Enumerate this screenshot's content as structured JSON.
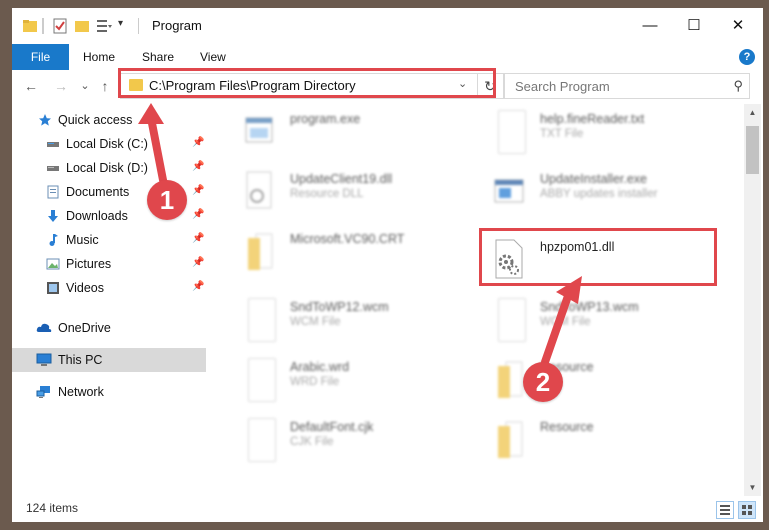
{
  "window": {
    "title": "Program",
    "controls": {
      "minimize": "—",
      "maximize": "☐",
      "close": "✕"
    }
  },
  "ribbon": {
    "tabs": [
      "File",
      "Home",
      "Share",
      "View"
    ],
    "help": "?"
  },
  "navigation": {
    "back": "←",
    "forward": "→",
    "recent": "⌄",
    "up": "↑",
    "address": "C:\\Program Files\\Program Directory",
    "dropdown": "⌄",
    "refresh": "↻",
    "search_placeholder": "Search Program",
    "search_icon": "⚲"
  },
  "sidebar": {
    "items": [
      {
        "label": "Quick access",
        "icon": "star-icon",
        "pinned": false
      },
      {
        "label": "Local Disk (C:)",
        "icon": "drive-icon",
        "pinned": true
      },
      {
        "label": "Local Disk (D:)",
        "icon": "drive-icon",
        "pinned": true
      },
      {
        "label": "Documents",
        "icon": "documents-icon",
        "pinned": true
      },
      {
        "label": "Downloads",
        "icon": "download-icon",
        "pinned": true
      },
      {
        "label": "Music",
        "icon": "music-icon",
        "pinned": true
      },
      {
        "label": "Pictures",
        "icon": "pictures-icon",
        "pinned": true
      },
      {
        "label": "Videos",
        "icon": "video-icon",
        "pinned": true
      },
      {
        "label": "OneDrive",
        "icon": "cloud-icon",
        "pinned": false
      },
      {
        "label": "This PC",
        "icon": "computer-icon",
        "pinned": false,
        "selected": true
      },
      {
        "label": "Network",
        "icon": "network-icon",
        "pinned": false
      }
    ],
    "pin_glyph": "📌"
  },
  "files": [
    {
      "name": "program.exe",
      "type": "",
      "icon": "exe-icon"
    },
    {
      "name": "help.fineReader.txt",
      "type": "TXT File",
      "icon": "text-file-icon"
    },
    {
      "name": "UpdateClient19.dll",
      "type": "Resource DLL",
      "icon": "dll-icon"
    },
    {
      "name": "UpdateInstaller.exe",
      "type": "ABBY updates installer",
      "icon": "installer-icon"
    },
    {
      "name": "Microsoft.VC90.CRT",
      "type": "",
      "icon": "folder-icon"
    },
    {
      "name": "hpzpom01.dll",
      "type": "",
      "icon": "dll-gear-icon"
    },
    {
      "name": "SndToWP12.wcm",
      "type": "WCM File",
      "icon": "file-icon"
    },
    {
      "name": "SndToWP13.wcm",
      "type": "WCM File",
      "icon": "file-icon"
    },
    {
      "name": "Arabic.wrd",
      "type": "WRD File",
      "icon": "file-icon"
    },
    {
      "name": "Resource",
      "type": "",
      "icon": "folder-icon"
    },
    {
      "name": "DefaultFont.cjk",
      "type": "CJK File",
      "icon": "file-icon"
    },
    {
      "name": "Resource",
      "type": "",
      "icon": "folder-icon"
    }
  ],
  "status": {
    "item_count": "124 items"
  },
  "annotations": {
    "step1": "1",
    "step2": "2",
    "color": "#e0474c"
  }
}
